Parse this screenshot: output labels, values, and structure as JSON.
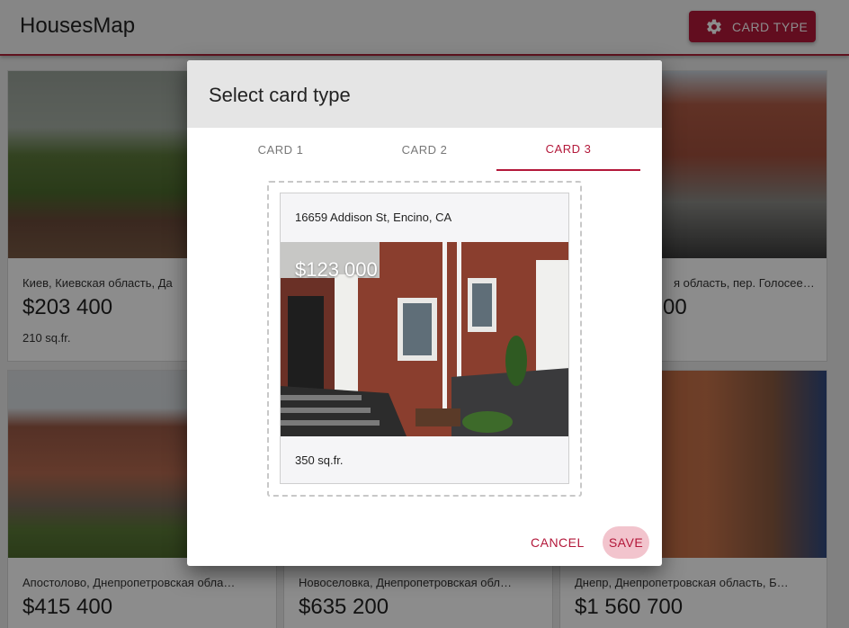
{
  "app": {
    "title": "HousesMap",
    "card_type_button": "CARD TYPE",
    "accent_color": "#b3183a"
  },
  "listings": [
    {
      "address": "Киев, Киевская область, Да",
      "price": "$203 400",
      "area": "210 sq.fr."
    },
    {
      "address": "я область, пер. Голосее…",
      "price": "00",
      "area": ""
    },
    {
      "address": "Апостолово, Днепропетровская обла…",
      "price": "$415 400"
    },
    {
      "address": "Новоселовка, Днепропетровская обл…",
      "price": "$635 200"
    },
    {
      "address": "Днепр, Днепропетровская область, Б…",
      "price": "$1 560 700"
    }
  ],
  "dialog": {
    "title": "Select card type",
    "tabs": [
      {
        "label": "CARD 1",
        "active": false
      },
      {
        "label": "CARD 2",
        "active": false
      },
      {
        "label": "CARD 3",
        "active": true
      }
    ],
    "preview": {
      "address": "16659 Addison St, Encino, CA",
      "price": "$123 000",
      "area": "350 sq.fr."
    },
    "cancel_label": "CANCEL",
    "save_label": "SAVE"
  }
}
